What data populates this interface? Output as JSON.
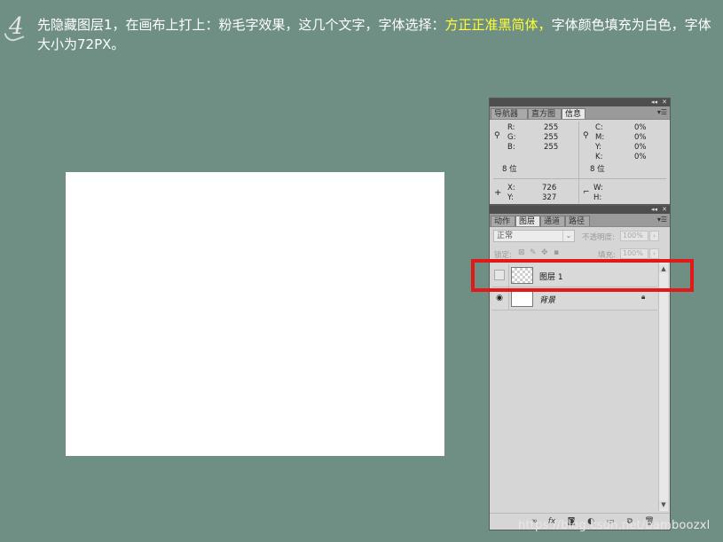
{
  "step": {
    "number": "4"
  },
  "instruction": {
    "part1": "先隐藏图层1，在画布上打上：粉毛字效果，这几个文字，字体选择：",
    "highlight": "方正正准黑简体，",
    "part2": "字体颜色填充为白色，字体大小为72PX。"
  },
  "colors": {
    "background": "#6f8f84",
    "highlight_text": "#ffff33",
    "box": "#e11919"
  },
  "info_panel": {
    "tabs": [
      {
        "label": "导航器"
      },
      {
        "label": "直方图"
      },
      {
        "label": "信息",
        "active": true
      }
    ],
    "rgb": {
      "r_label": "R:",
      "r": "255",
      "g_label": "G:",
      "g": "255",
      "b_label": "B:",
      "b": "255"
    },
    "cmyk": {
      "c_label": "C:",
      "c": "0%",
      "m_label": "M:",
      "m": "0%",
      "y_label": "Y:",
      "y": "0%",
      "k_label": "K:",
      "k": "0%"
    },
    "bit_left": "8 位",
    "bit_right": "8 位",
    "xy": {
      "x_label": "X:",
      "x": "726",
      "y_label": "Y:",
      "y": "327"
    },
    "wh": {
      "w_label": "W:",
      "h_label": "H:"
    },
    "icons": [
      "eyedropper-icon",
      "crosshair-icon",
      "selection-icon"
    ]
  },
  "layers_panel": {
    "tabs": [
      {
        "label": "动作"
      },
      {
        "label": "图层",
        "active": true
      },
      {
        "label": "通道"
      },
      {
        "label": "路径"
      }
    ],
    "blend_mode": "正常",
    "opacity_label": "不透明度:",
    "opacity_value": "100%",
    "lock_label": "锁定:",
    "fill_label": "填充:",
    "fill_value": "100%",
    "layers": [
      {
        "name": "图层 1",
        "visible": false
      },
      {
        "name": "背景",
        "visible": true,
        "locked": true
      }
    ]
  },
  "watermark": "https://blog.csdn.net/bamboozxl"
}
